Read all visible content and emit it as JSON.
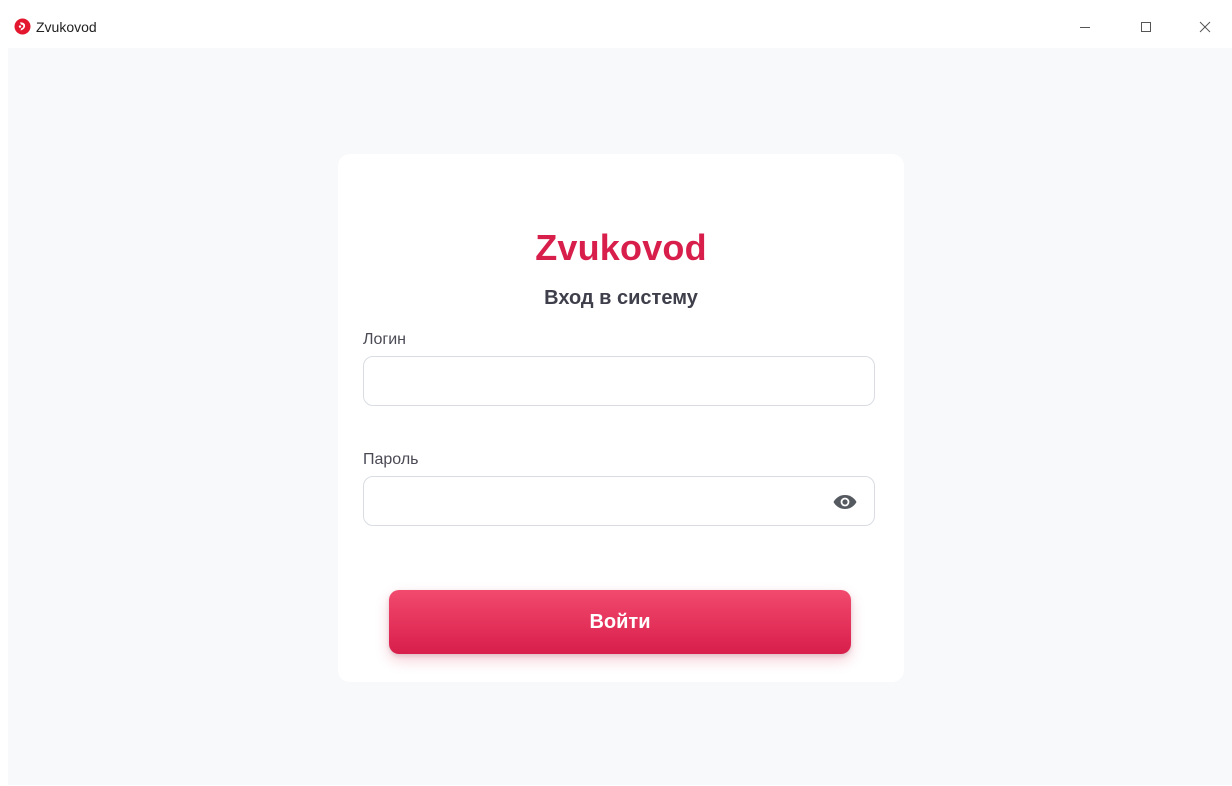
{
  "window": {
    "title": "Zvukovod",
    "controls": {
      "minimize_icon": "minimize-icon",
      "maximize_icon": "maximize-icon",
      "close_icon": "close-icon"
    }
  },
  "login": {
    "brand": "Zvukovod",
    "subtitle": "Вход в систему",
    "login_label": "Логин",
    "login_value": "",
    "login_placeholder": "",
    "password_label": "Пароль",
    "password_value": "",
    "password_placeholder": "",
    "password_toggle_icon": "eye-icon",
    "submit_label": "Войти"
  },
  "colors": {
    "accent": "#d81e4b",
    "accent_light": "#f24a6e",
    "background": "#f8f9fb",
    "card": "#ffffff",
    "subtitle_text": "#3e3f4b"
  }
}
